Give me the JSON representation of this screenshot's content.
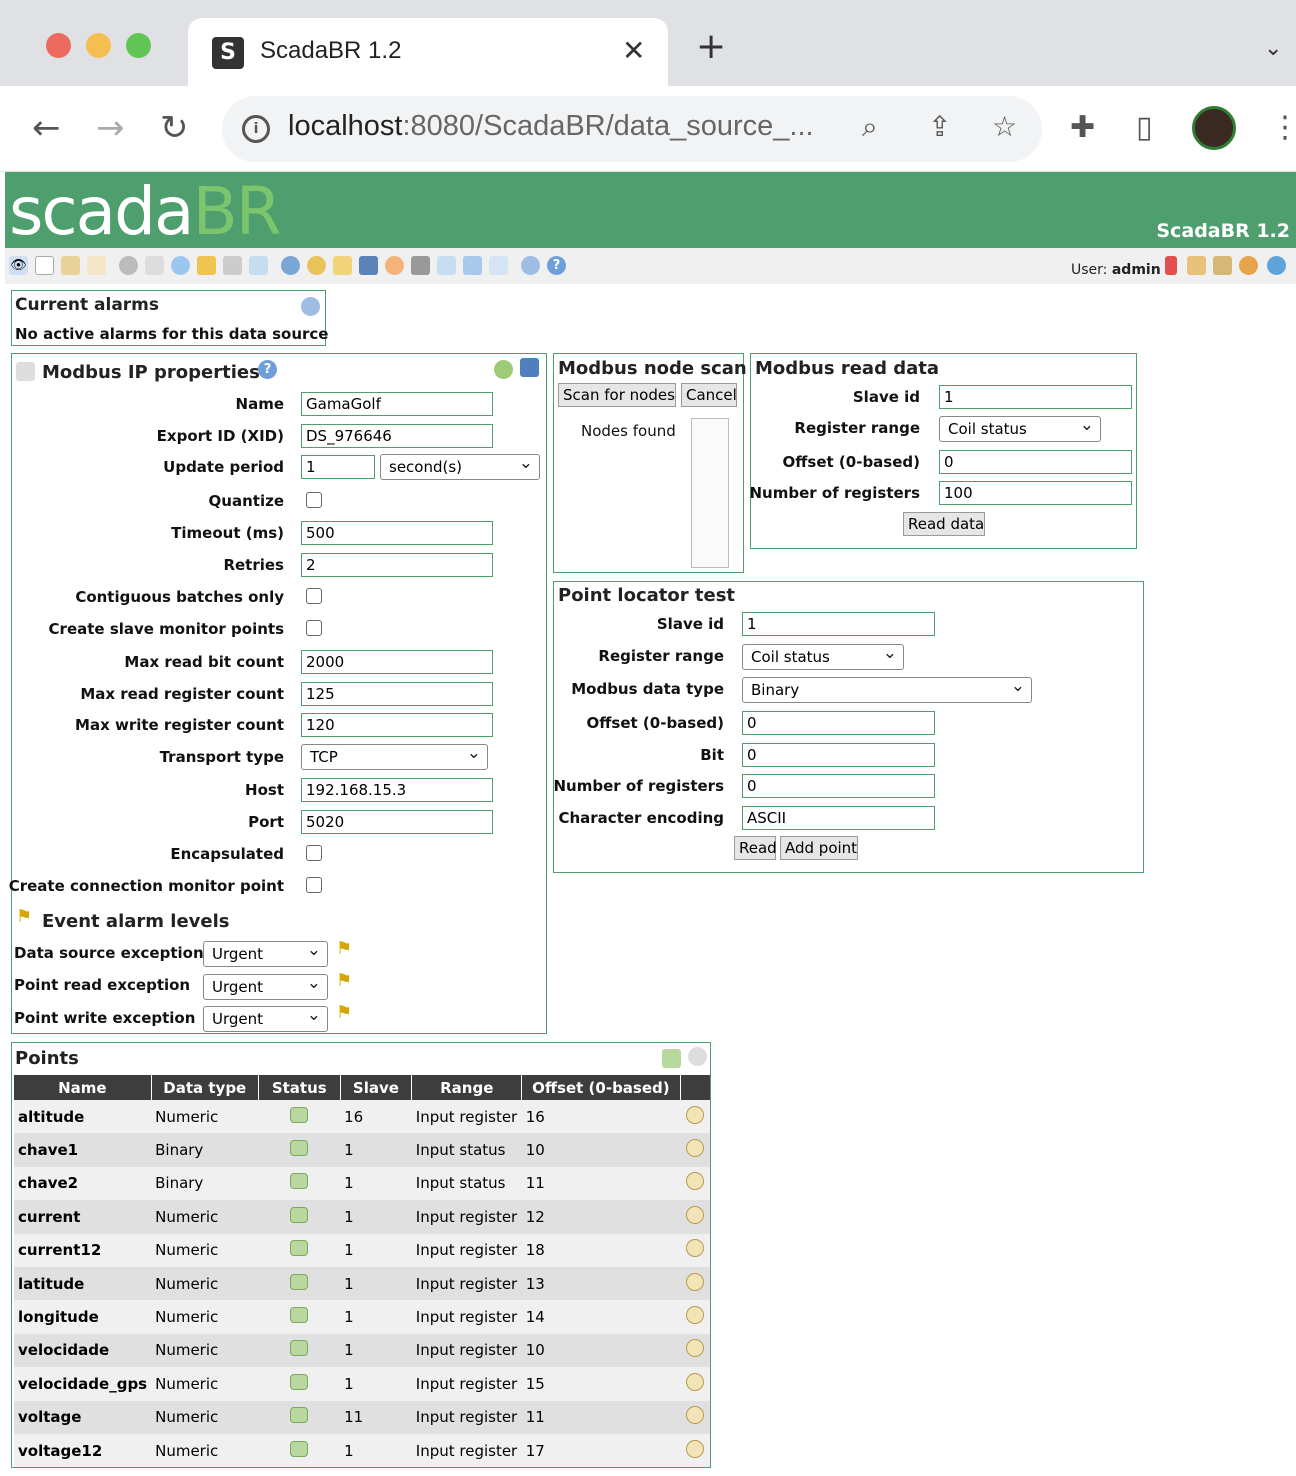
{
  "browser": {
    "tab_title": "ScadaBR 1.2",
    "tab_close": "✕",
    "new_tab": "+",
    "url_host": "localhost",
    "url_rest": ":8080/ScadaBR/data_source_...",
    "icons": [
      "back-icon",
      "forward-icon",
      "reload-icon",
      "zoom-icon",
      "share-icon",
      "star-icon",
      "extensions-icon",
      "sidepanel-icon",
      "profile-avatar",
      "menu-icon"
    ]
  },
  "app": {
    "logo_white": "scada",
    "logo_green": "BR",
    "version": "ScadaBR 1.2",
    "user_label": "User:",
    "user_name": "admin",
    "brand_color": "#4e9e6e"
  },
  "alarms": {
    "title": "Current alarms",
    "message": "No active alarms for this data source"
  },
  "properties": {
    "title": "Modbus IP properties",
    "name_label": "Name",
    "name": "GamaGolf",
    "xid_label": "Export ID (XID)",
    "xid": "DS_976646",
    "update_label": "Update period",
    "update_value": "1",
    "update_unit": "second(s)",
    "quantize_label": "Quantize",
    "timeout_label": "Timeout (ms)",
    "timeout": "500",
    "retries_label": "Retries",
    "retries": "2",
    "contiguous_label": "Contiguous batches only",
    "slave_monitor_label": "Create slave monitor points",
    "max_bit_label": "Max read bit count",
    "max_bit": "2000",
    "max_reg_label": "Max read register count",
    "max_reg": "125",
    "max_write_label": "Max write register count",
    "max_write": "120",
    "transport_label": "Transport type",
    "transport": "TCP",
    "host_label": "Host",
    "host": "192.168.15.3",
    "port_label": "Port",
    "port": "5020",
    "encapsulated_label": "Encapsulated",
    "conn_monitor_label": "Create connection monitor point",
    "event_title": "Event alarm levels",
    "ds_exc_label": "Data source exception",
    "ds_exc": "Urgent",
    "read_exc_label": "Point read exception",
    "read_exc": "Urgent",
    "write_exc_label": "Point write exception",
    "write_exc": "Urgent"
  },
  "scan": {
    "title": "Modbus node scan",
    "scan_button": "Scan for nodes",
    "cancel_button": "Cancel",
    "nodes_label": "Nodes found"
  },
  "read_data": {
    "title": "Modbus read data",
    "slave_label": "Slave id",
    "slave": "1",
    "range_label": "Register range",
    "range": "Coil status",
    "offset_label": "Offset (0-based)",
    "offset": "0",
    "count_label": "Number of registers",
    "count": "100",
    "read_button": "Read data"
  },
  "locator": {
    "title": "Point locator test",
    "slave_label": "Slave id",
    "slave": "1",
    "range_label": "Register range",
    "range": "Coil status",
    "type_label": "Modbus data type",
    "type": "Binary",
    "offset_label": "Offset (0-based)",
    "offset": "0",
    "bit_label": "Bit",
    "bit": "0",
    "count_label": "Number of registers",
    "count": "0",
    "enc_label": "Character encoding",
    "enc": "ASCII",
    "read_button": "Read",
    "add_button": "Add point"
  },
  "points": {
    "title": "Points",
    "columns": [
      "Name",
      "Data type",
      "Status",
      "Slave",
      "Range",
      "Offset (0-based)"
    ],
    "rows": [
      {
        "name": "altitude",
        "type": "Numeric",
        "slave": "16",
        "range": "Input register",
        "offset": "16"
      },
      {
        "name": "chave1",
        "type": "Binary",
        "slave": "1",
        "range": "Input status",
        "offset": "10"
      },
      {
        "name": "chave2",
        "type": "Binary",
        "slave": "1",
        "range": "Input status",
        "offset": "11"
      },
      {
        "name": "current",
        "type": "Numeric",
        "slave": "1",
        "range": "Input register",
        "offset": "12"
      },
      {
        "name": "current12",
        "type": "Numeric",
        "slave": "1",
        "range": "Input register",
        "offset": "18"
      },
      {
        "name": "latitude",
        "type": "Numeric",
        "slave": "1",
        "range": "Input register",
        "offset": "13"
      },
      {
        "name": "longitude",
        "type": "Numeric",
        "slave": "1",
        "range": "Input register",
        "offset": "14"
      },
      {
        "name": "velocidade",
        "type": "Numeric",
        "slave": "1",
        "range": "Input register",
        "offset": "10"
      },
      {
        "name": "velocidade_gps",
        "type": "Numeric",
        "slave": "1",
        "range": "Input register",
        "offset": "15"
      },
      {
        "name": "voltage",
        "type": "Numeric",
        "slave": "11",
        "range": "Input register",
        "offset": "11"
      },
      {
        "name": "voltage12",
        "type": "Numeric",
        "slave": "1",
        "range": "Input register",
        "offset": "17"
      }
    ]
  }
}
